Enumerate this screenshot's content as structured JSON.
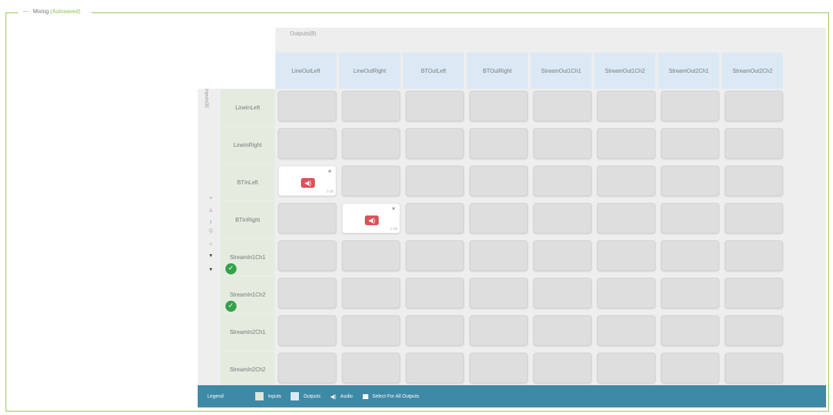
{
  "fieldset": {
    "legend": "Mixing",
    "status": "(Autosaved)"
  },
  "outputs_label": "Outputs(8)",
  "inputs_label": "Inputs(8)",
  "columns": [
    "LineOutLeft",
    "LineOutRight",
    "BTOutLeft",
    "BTOutRight",
    "StreamOut1Ch1",
    "StreamOut1Ch2",
    "StreamOut2Ch1",
    "StreamOut2Ch2"
  ],
  "rows": [
    {
      "label": "LineInLeft",
      "selected": false
    },
    {
      "label": "LineInRight",
      "selected": false
    },
    {
      "label": "BTInLeft",
      "selected": false
    },
    {
      "label": "BTInRight",
      "selected": false
    },
    {
      "label": "StreamIn1Ch1",
      "selected": true
    },
    {
      "label": "StreamIn1Ch2",
      "selected": true
    },
    {
      "label": "StreamIn2Ch1",
      "selected": false
    },
    {
      "label": "StreamIn2Ch2",
      "selected": false
    }
  ],
  "active_cells": [
    {
      "row": 2,
      "col": 0,
      "icon": "speaker-icon",
      "close": "×",
      "gain": "0 dB"
    },
    {
      "row": 3,
      "col": 1,
      "icon": "speaker-icon",
      "close": "×",
      "gain": "0 dB"
    }
  ],
  "controls": [
    "≡",
    "A",
    "I",
    "Q",
    "=",
    "▼",
    "▼"
  ],
  "legend_bar": {
    "title": "Legend",
    "inputs": "Inputs",
    "outputs": "Outputs",
    "audio": "Audio",
    "select_all": "Select For All Outputs",
    "colors": {
      "bar": "#3e8aa6",
      "inputs_swatch": "#dce8d8",
      "outputs_swatch": "#dbe9f5",
      "check": "#33a24b",
      "speaker": "#e04f5a"
    }
  }
}
